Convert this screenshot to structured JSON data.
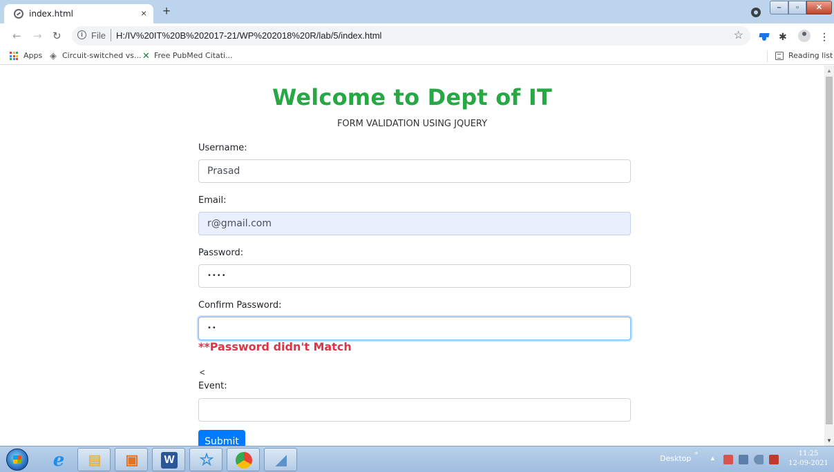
{
  "browser": {
    "tab": {
      "title": "index.html",
      "close_glyph": "×"
    },
    "new_tab_glyph": "+",
    "url": {
      "scheme_label": "File",
      "path": "H:/IV%20IT%20B%202017-21/WP%202018%20R/lab/5/index.html"
    },
    "bookmarks": [
      {
        "label": "Apps",
        "icon": "apps-grid-icon"
      },
      {
        "label": "Circuit-switched vs...",
        "icon": "site-icon"
      },
      {
        "label": "Free PubMed Citati...",
        "icon": "x-icon"
      }
    ],
    "reading_list_label": "Reading list"
  },
  "page": {
    "heading": "Welcome to Dept of IT",
    "subheading": "FORM VALIDATION USING JQUERY",
    "form": {
      "username_label": "Username:",
      "username_value": "Prasad",
      "email_label": "Email:",
      "email_value": "r@gmail.com",
      "password_label": "Password:",
      "password_value": "••••",
      "confirm_label": "Confirm Password:",
      "confirm_value": "••",
      "error": "**Password didn't Match",
      "stray_char": "<",
      "event_label": "Event:",
      "event_value": "",
      "submit_label": "Submit"
    },
    "colors": {
      "heading": "#28a745",
      "error": "#dc3545",
      "submit": "#007bff"
    }
  },
  "taskbar": {
    "apps": [
      "start-orb",
      "internet-explorer",
      "file-explorer",
      "media-player",
      "word",
      "star-app",
      "chrome",
      "notepad"
    ],
    "desktop_label": "Desktop",
    "time": "11:25",
    "date": "12-09-2021"
  }
}
